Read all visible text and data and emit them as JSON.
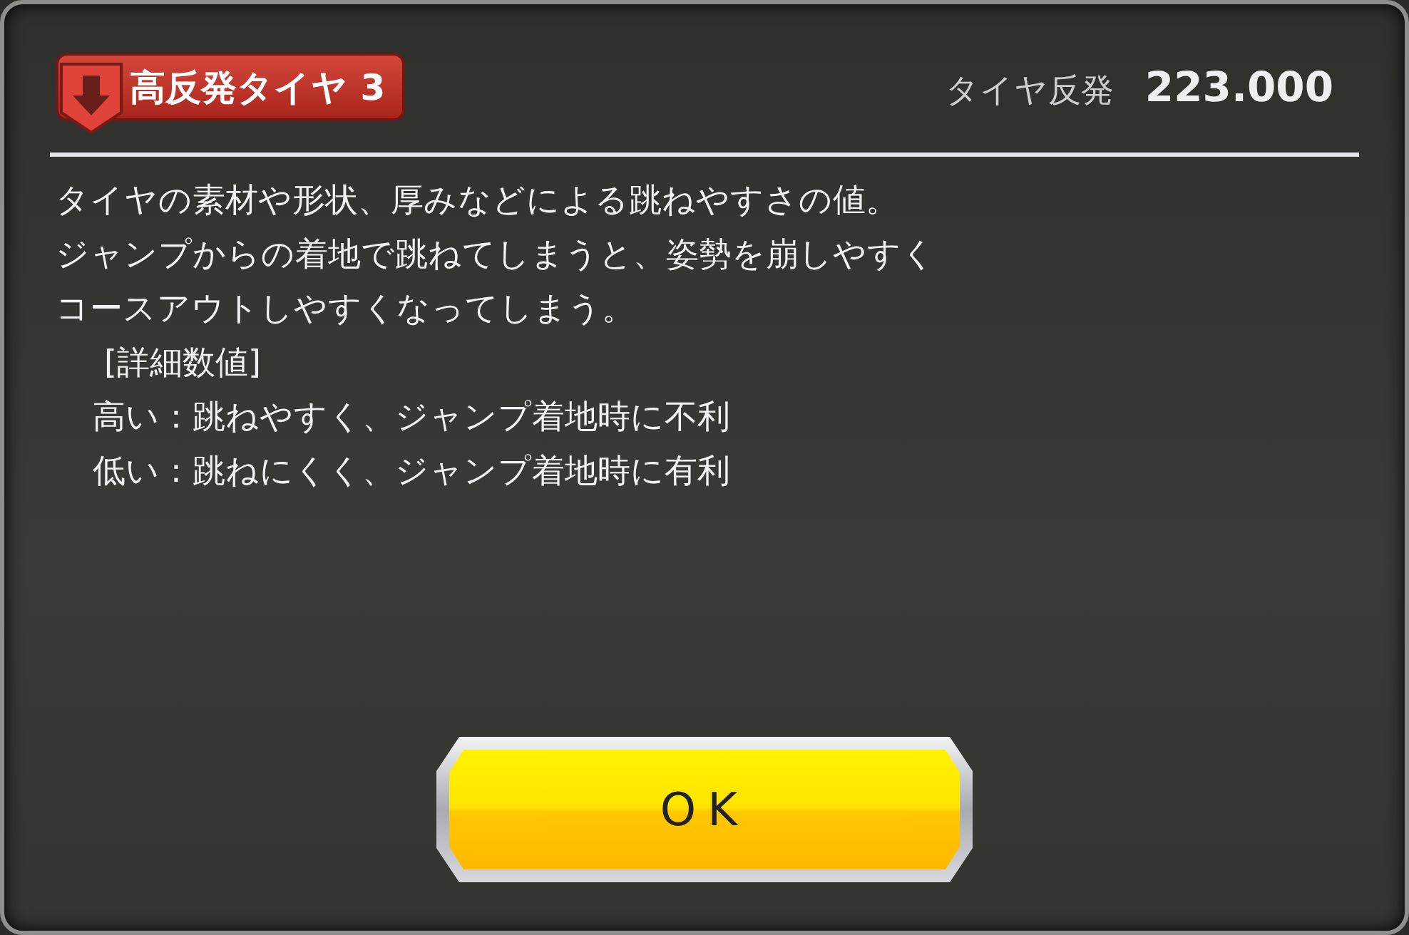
{
  "header": {
    "badge": {
      "title": "高反発タイヤ 3"
    },
    "stat": {
      "label": "タイヤ反発",
      "value": "223.000"
    }
  },
  "description": [
    "タイヤの素材や形状、厚みなどによる跳ねやすさの値。",
    "ジャンプからの着地で跳ねてしまうと、姿勢を崩しやすく",
    "コースアウトしやすくなってしまう。"
  ],
  "details": {
    "heading": "[詳細数値]",
    "lines": [
      "高い：跳ねやすく、ジャンプ着地時に不利",
      "低い：跳ねにくく、ジャンプ着地時に有利"
    ]
  },
  "button": {
    "label": "OK"
  }
}
